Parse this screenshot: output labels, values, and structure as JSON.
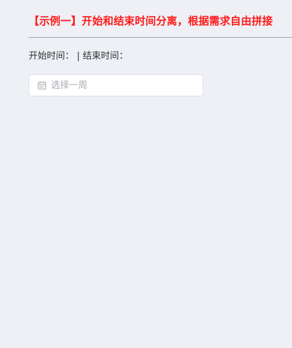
{
  "header": {
    "title": "【示例一】开始和结束时间分离，根据需求自由拼接"
  },
  "time_display": {
    "start_label": "开始时间：",
    "start_value": "",
    "separator": "|",
    "end_label": "结束时间：",
    "end_value": ""
  },
  "week_picker": {
    "icon": "calendar-icon",
    "placeholder": "选择一周",
    "value": ""
  },
  "colors": {
    "title": "#ff1a1a",
    "background": "#eef0f5",
    "border": "#dcdfe6",
    "placeholder": "#a8abb2"
  }
}
